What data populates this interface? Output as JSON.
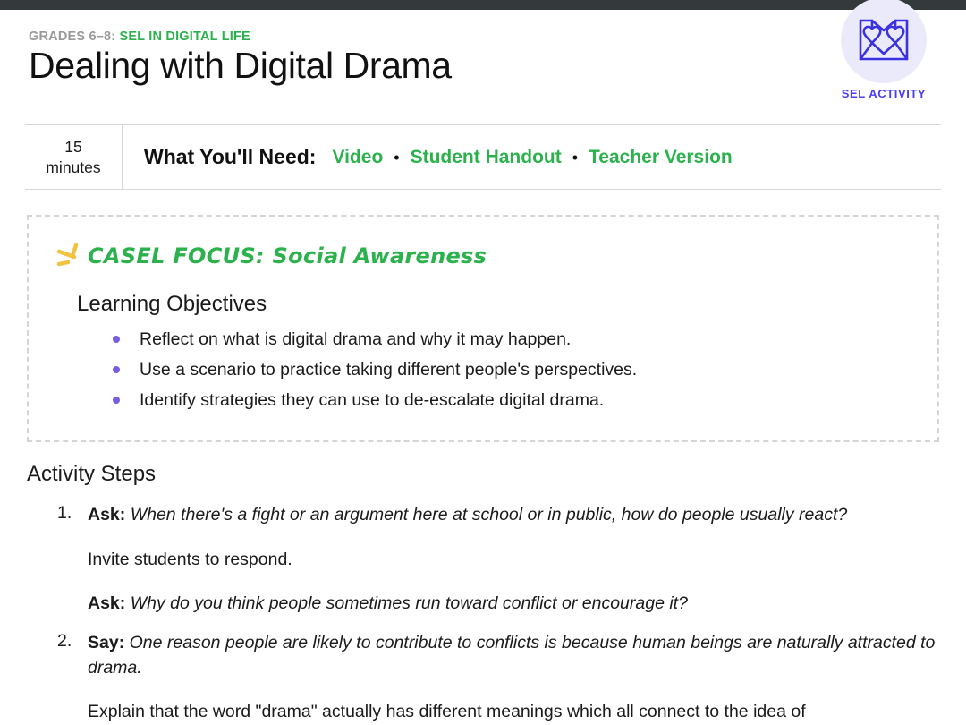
{
  "window": {
    "chrome_bar_color": "#343a3c"
  },
  "header": {
    "eyebrow_grades": "GRADES 6–8: ",
    "eyebrow_subject": "SEL IN DIGITAL LIFE",
    "title": "Dealing with Digital Drama",
    "badge": {
      "icon": "box-with-hearts-icon",
      "label": "SEL ACTIVITY",
      "accent_color": "#4b3ef0",
      "circle_color": "#eaeafb"
    },
    "accent_green": "#2bb24c"
  },
  "what_you_need": {
    "duration_value": "15",
    "duration_unit": "minutes",
    "label": "What You'll Need:",
    "separator": "•",
    "links": [
      "Video",
      "Student Handout",
      "Teacher Version"
    ]
  },
  "casel_box": {
    "spark_icon": "sparkle-burst-icon",
    "heading": "CASEL FOCUS: Social Awareness",
    "objectives_title": "Learning Objectives",
    "bullet_color": "#7a5ce0",
    "objectives": [
      "Reflect on what is digital drama and why it may happen.",
      "Use a scenario to practice taking different people's perspectives.",
      "Identify strategies they can use to de-escalate digital drama."
    ]
  },
  "activity_steps": {
    "title": "Activity Steps",
    "steps": [
      {
        "number": "1.",
        "lines": [
          {
            "lead": "Ask",
            "sep": ": ",
            "text": "When there's a fight or an argument here at school or in public, how do people usually react?",
            "italic": true
          },
          {
            "lead": "",
            "sep": "",
            "text": "Invite students to respond.",
            "italic": false
          },
          {
            "lead": "Ask",
            "sep": ": ",
            "text": "Why do you think people sometimes run toward conflict or encourage it?",
            "italic": true
          }
        ]
      },
      {
        "number": "2.",
        "lines": [
          {
            "lead": "Say",
            "sep": ":  ",
            "text": "One reason people are likely to contribute to conflicts is because human beings are naturally attracted to drama.",
            "italic": true
          },
          {
            "lead": "",
            "sep": "",
            "text": "Explain that the word \"drama\" actually has different meanings which all connect to the idea of",
            "italic": false
          }
        ]
      }
    ]
  }
}
